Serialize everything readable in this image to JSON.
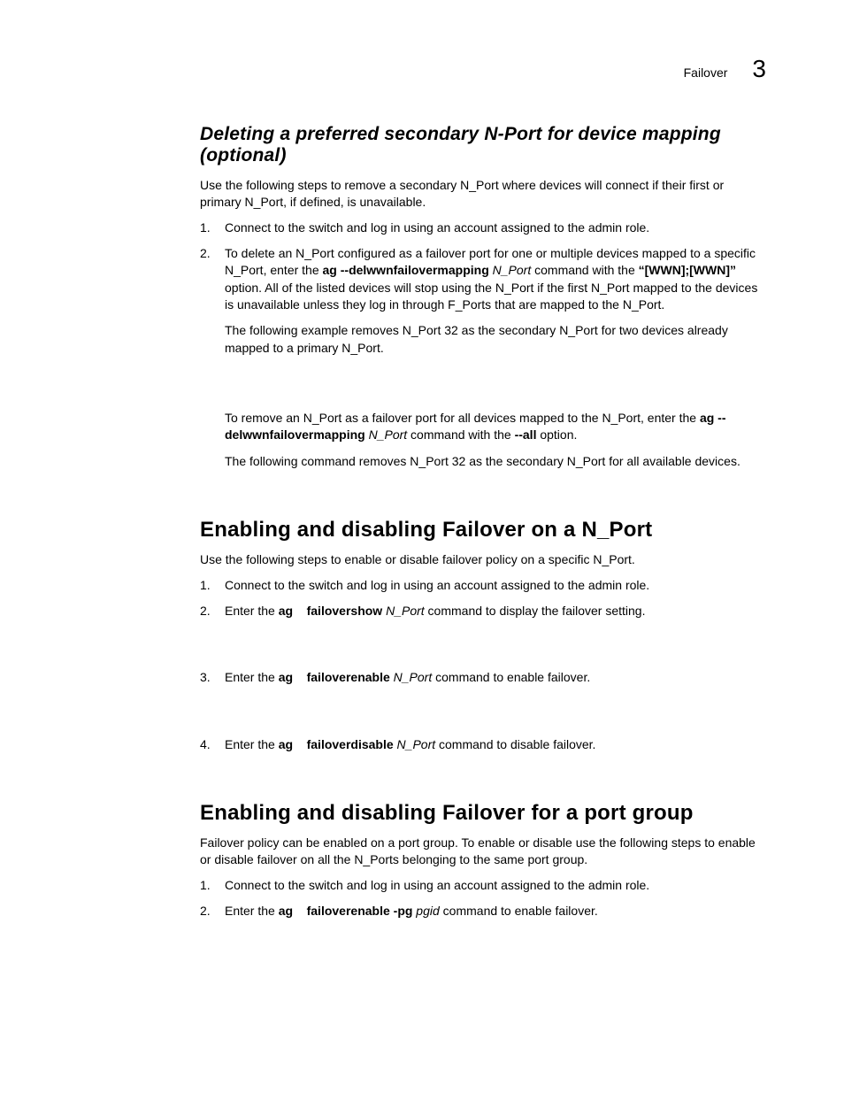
{
  "header": {
    "title": "Failover",
    "chapter": "3"
  },
  "section1": {
    "heading": "Deleting a preferred secondary N-Port for device mapping (optional)",
    "intro": "Use the following steps to remove a secondary N_Port where devices will connect if their first or primary N_Port, if defined, is unavailable.",
    "step1": "Connect to the switch and log in using an account assigned to the admin role.",
    "step2a": "To delete an N_Port configured as a failover port for one or multiple devices mapped to a specific N_Port, enter the ",
    "step2_cmd1": "ag --delwwnfailovermapping",
    "step2_arg1": " N_Port",
    "step2b": " command with the ",
    "step2_opt": "“[WWN];[WWN]”",
    "step2c": " option. All of the listed devices will stop using the N_Port if the first N_Port mapped to the devices is unavailable unless they log in through F_Ports that are mapped to the N_Port.",
    "step2_p2": "The following example removes N_Port 32 as the secondary N_Port for two devices already mapped to a primary N_Port.",
    "step2_p3a": "To remove an N_Port as a failover port for all devices mapped to the N_Port, enter the ",
    "step2_p3_cmd": "ag --delwwnfailovermapping",
    "step2_p3_arg": " N_Port",
    "step2_p3b": " command with the ",
    "step2_p3_opt": "--all",
    "step2_p3c": " option.",
    "step2_p4": "The following command removes N_Port 32 as the secondary N_Port for all available devices."
  },
  "section2": {
    "heading": "Enabling and disabling Failover on a N_Port",
    "intro": "Use the following steps to enable or disable failover policy on a specific N_Port.",
    "step1": "Connect to the switch and log in using an account assigned to the admin role.",
    "step2a": "Enter the ",
    "step2_cmd_ag": "ag",
    "step2_sep": " –– ",
    "step2_cmd": "failovershow",
    "step2_arg": " N_Port",
    "step2b": " command to display the failover setting.",
    "step3a": "Enter the ",
    "step3_cmd_ag": "ag",
    "step3_cmd": "failoverenable",
    "step3_arg": " N_Port",
    "step3b": " command to enable failover.",
    "step4a": "Enter the ",
    "step4_cmd_ag": "ag",
    "step4_cmd": "failoverdisable",
    "step4_arg": " N_Port",
    "step4b": " command to disable failover."
  },
  "section3": {
    "heading": "Enabling and disabling Failover for a port group",
    "intro": "Failover policy can be enabled on a port group. To enable or disable use the following steps to enable or disable failover on all the N_Ports belonging to the same port group.",
    "step1": "Connect to the switch and log in using an account assigned to the admin role.",
    "step2a": "Enter the ",
    "step2_cmd_ag": "ag",
    "step2_cmd": "failoverenable -pg",
    "step2_arg": " pgid",
    "step2b": " command to enable failover."
  }
}
